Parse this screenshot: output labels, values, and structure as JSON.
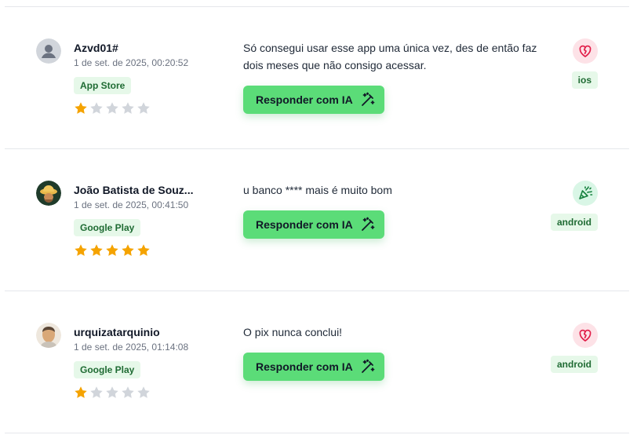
{
  "reviews": [
    {
      "author": "Azvd01#",
      "date": "1 de set. de 2025, 00:20:52",
      "store": "App Store",
      "rating": 1,
      "rating_max": 5,
      "comment": "Só consegui usar esse app uma única vez, des de então faz dois meses que não consigo acessar.",
      "reply_button": "Responder com IA",
      "sentiment_icon": "broken-heart-icon",
      "sentiment_color": "#fde2e7",
      "platform": "ios",
      "avatar": "default-user-avatar"
    },
    {
      "author": "João Batista de Souz...",
      "date": "1 de set. de 2025, 00:41:50",
      "store": "Google Play",
      "rating": 5,
      "rating_max": 5,
      "comment": "u banco **** mais é muito bom",
      "reply_button": "Responder com IA",
      "sentiment_icon": "party-popper-icon",
      "sentiment_color": "#d9f6e6",
      "platform": "android",
      "avatar": "user-photo-avatar"
    },
    {
      "author": "urquizatarquinio",
      "date": "1 de set. de 2025, 01:14:08",
      "store": "Google Play",
      "rating": 1,
      "rating_max": 5,
      "comment": "O pix nunca conclui!",
      "reply_button": "Responder com IA",
      "sentiment_icon": "broken-heart-icon",
      "sentiment_color": "#fde2e7",
      "platform": "android",
      "avatar": "user-photo-avatar"
    }
  ],
  "colors": {
    "star_filled": "#f5a300",
    "star_empty": "#d1d5db",
    "button_bg": "#5bdc78",
    "badge_bg": "#e6f8e9",
    "badge_text": "#1f6b33"
  }
}
